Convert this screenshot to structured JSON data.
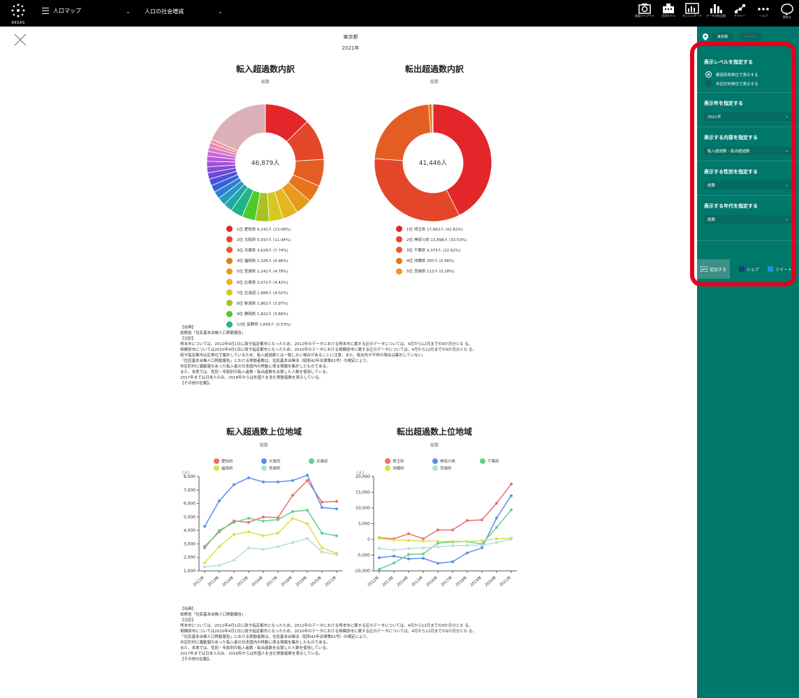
{
  "topbar": {
    "logo_text": "RESAS",
    "menu_label": "人口マップ",
    "category_label": "人口の社会増減",
    "tools": [
      {
        "icon": "camera-icon",
        "label": "画面キャプチャ"
      },
      {
        "icon": "building-icon",
        "label": "活用モデル"
      },
      {
        "icon": "dashboard-icon",
        "label": "ダッシュボード"
      },
      {
        "icon": "bar-chart-icon",
        "label": "データ分析支援"
      },
      {
        "icon": "summary-icon",
        "label": "サマリー"
      },
      {
        "icon": "more-icon",
        "label": "ヘルプ"
      },
      {
        "icon": "chat-icon",
        "label": "問合せ"
      }
    ]
  },
  "header": {
    "region": "東京都",
    "year": "2021年"
  },
  "pie_in": {
    "title": "転入超過数内訳",
    "subtitle": "総数",
    "center": "46,879人",
    "legend": [
      {
        "text": "1位 愛知県 6,141人 (13.08%)",
        "color": "#e3262a"
      },
      {
        "text": "2位 大阪府 5,597人 (11.94%)",
        "color": "#e4462a"
      },
      {
        "text": "3位 兵庫県 3,628人 (7.74%)",
        "color": "#e45e24"
      },
      {
        "text": "4位 福岡県 2,326人 (4.96%)",
        "color": "#e6761d"
      },
      {
        "text": "5位 宮城県 2,242人 (4.78%)",
        "color": "#e89a1d"
      },
      {
        "text": "6位 広島県 2,072人 (4.42%)",
        "color": "#e6b520"
      },
      {
        "text": "7位 北海道 1,886人 (4.02%)",
        "color": "#d6c820"
      },
      {
        "text": "8位 新潟県 1,862人 (3.97%)",
        "color": "#a8c224"
      },
      {
        "text": "9位 静岡県 1,822人 (3.89%)",
        "color": "#4ccb2b"
      },
      {
        "text": "10位 長野県 1,656人 (3.53%)",
        "color": "#1fb48a"
      }
    ]
  },
  "pie_out": {
    "title": "転出超過数内訳",
    "subtitle": "総数",
    "center": "41,446人",
    "legend": [
      {
        "text": "1位 埼玉県 17,662人 (42.62%)",
        "color": "#e3262a"
      },
      {
        "text": "2位 神奈川県 13,898人 (33.53%)",
        "color": "#e4462a"
      },
      {
        "text": "3位 千葉県 9,375人 (22.62%)",
        "color": "#e45e24"
      },
      {
        "text": "4位 沖縄県 397人 (0.96%)",
        "color": "#e6761d"
      },
      {
        "text": "5位 茨城県 113人 (0.28%)",
        "color": "#e89a1d"
      }
    ]
  },
  "notes1": [
    "【出典】",
    "総務省「住民基本台帳人口移動報告」",
    "【注記】",
    "熊本市については、2012年4月1日に政令指定都市となったため、2012年のデータにおける熊本市に属する区のデータについては、4月から12月までの9か月分とな る。",
    "相模原市については2010年4月1日に政令指定都市となったため、2010年のデータにおける相模原市に属する区のデータについては、4月から12月までの9か月分とな る。",
    "政令指定都市は区単位で集計しているため、転入超過数とは一致しない場合があることに注意。また、転出先が不詳の場合は集計していない。",
    "「住民基本台帳人口移動報告」における移動者数は、住民基本台帳法（昭和42年法律第81号）の規定により、",
    "市区町村に異動届のあった転入者の日本国内の移動に係る情報を集計したものである。",
    "また、本表では、性別・年齢別の転入者数・転出者数を合算した人数を使用している。",
    "2017年までは日本人のみ、2018年からは外国人を含む移動者数を表示している。",
    "【その他の記載】。"
  ],
  "line_in": {
    "title": "転入超過数上位地域",
    "subtitle": "総数",
    "yunit": "（人）",
    "chart_data": {
      "type": "line",
      "x": [
        "2012年",
        "2013年",
        "2014年",
        "2015年",
        "2016年",
        "2017年",
        "2018年",
        "2019年",
        "2020年",
        "2021年"
      ],
      "ylim": [
        1000,
        8000
      ],
      "yticks": [
        "1,000",
        "2,000",
        "3,000",
        "4,000",
        "5,000",
        "6,000",
        "7,000",
        "8,000"
      ],
      "series": [
        {
          "name": "愛知県",
          "color": "#f06b6b",
          "values": [
            2800,
            3900,
            4700,
            4600,
            5000,
            4950,
            6600,
            7700,
            6100,
            6150
          ]
        },
        {
          "name": "大阪府",
          "color": "#5b8fe8",
          "values": [
            4300,
            6200,
            7400,
            7900,
            7600,
            7600,
            7700,
            8100,
            5700,
            5600
          ]
        },
        {
          "name": "兵庫県",
          "color": "#63cf8f",
          "values": [
            2700,
            4000,
            4600,
            4900,
            4700,
            4800,
            5400,
            5500,
            3800,
            3600
          ]
        },
        {
          "name": "福岡県",
          "color": "#d8e04a",
          "values": [
            1600,
            2800,
            3700,
            3900,
            3600,
            3800,
            4900,
            4500,
            2700,
            2300
          ]
        },
        {
          "name": "宮城県",
          "color": "#b4e0d0",
          "values": [
            1300,
            1400,
            1800,
            2700,
            2600,
            2800,
            3100,
            3400,
            2400,
            2200
          ]
        }
      ]
    }
  },
  "line_out": {
    "title": "転出超過数上位地域",
    "subtitle": "総数",
    "yunit": "（人）",
    "chart_data": {
      "type": "line",
      "x": [
        "2012年",
        "2013年",
        "2014年",
        "2015年",
        "2016年",
        "2017年",
        "2018年",
        "2019年",
        "2020年",
        "2021年"
      ],
      "ylim": [
        -10000,
        20000
      ],
      "yticks": [
        "-10,000",
        "-5,000",
        "0",
        "5,000",
        "10,000",
        "15,000",
        "20,000"
      ],
      "series": [
        {
          "name": "埼玉県",
          "color": "#f06b6b",
          "values": [
            500,
            200,
            1800,
            200,
            3000,
            3000,
            6000,
            6200,
            11500,
            17600
          ]
        },
        {
          "name": "神奈川県",
          "color": "#5b8fe8",
          "values": [
            -5800,
            -5300,
            -6200,
            -6000,
            -7600,
            -7100,
            -4300,
            -2700,
            6800,
            13900
          ]
        },
        {
          "name": "千葉県",
          "color": "#63cf8f",
          "values": [
            -9500,
            -7500,
            -4800,
            -4600,
            -1200,
            -800,
            -700,
            -1500,
            3800,
            9400
          ]
        },
        {
          "name": "沖縄県",
          "color": "#d8e04a",
          "values": [
            300,
            -200,
            -300,
            -500,
            -600,
            -600,
            -700,
            -400,
            200,
            400
          ]
        },
        {
          "name": "茨城県",
          "color": "#b4e0d0",
          "values": [
            -2900,
            -3400,
            -2900,
            -2700,
            -2400,
            -2000,
            -1900,
            -1800,
            -1000,
            100
          ]
        }
      ]
    }
  },
  "notes2": [
    "【出典】",
    "総務省「住民基本台帳人口移動報告」",
    "【注記】",
    "熊本市については、2012年4月1日に政令指定都市となったため、2012年のデータにおける熊本市に属する区のデータについては、4月から12月までの9か月分とな る。",
    "相模原市については2010年4月1日に政令指定都市となったため、2010年のデータにおける相模原市に属する区のデータについては、4月から12月までの9か月分とな る。",
    "「住民基本台帳人口移動報告」における移動者数は、住民基本台帳法（昭和42年法律第81号）の規定により、",
    "市区町村に異動届のあった転入者の日本国内の移動に係る情報を集計したものである。",
    "また、本表では、性別・年齢別の転入者数・転出者数を合算した人数を使用している。",
    "2017年までは日本人のみ、2018年からは外国人を含む移動者数を表示している。",
    "【その他の記載】。"
  ],
  "sidebar": {
    "pref": "東京都",
    "city": "－－－",
    "level_title": "表示レベルを指定する",
    "level_opt1": "都道府県単位で表示する",
    "level_opt2": "市区町村単位で表示する",
    "year_title": "表示年を指定する",
    "year_value": "2021年",
    "content_title": "表示する内容を指定する",
    "content_value": "転入超過数・転出超過数",
    "sex_title": "表示する性別を指定する",
    "sex_value": "総数",
    "age_title": "表示する年代を指定する",
    "age_value": "総数",
    "add_label": "追加する",
    "share_label": "シェア",
    "tweet_label": "ツイート"
  },
  "donut_in_values": [
    6141,
    5597,
    3628,
    2326,
    2242,
    2072,
    1886,
    1862,
    1822,
    1656,
    1200,
    1100,
    1000,
    950,
    900,
    850,
    800,
    750,
    700,
    650,
    600,
    550,
    500,
    9000
  ],
  "donut_in_colors": [
    "#e3262a",
    "#e4462a",
    "#e45e24",
    "#e6761d",
    "#e89a1d",
    "#e6b520",
    "#d6c820",
    "#a8c224",
    "#4ccb2b",
    "#1fb48a",
    "#20a8a8",
    "#239bc0",
    "#2a7fd0",
    "#3462d6",
    "#4a50d8",
    "#6a48d8",
    "#8a4ad8",
    "#a250d8",
    "#b85ad8",
    "#c868d8",
    "#d878c8",
    "#e888b0",
    "#f094a0",
    "#dcb0b8"
  ],
  "donut_out_values": [
    17662,
    13898,
    9375,
    397,
    113
  ],
  "donut_out_colors": [
    "#e3262a",
    "#e4462a",
    "#e45e24",
    "#e6761d",
    "#e89a1d"
  ]
}
